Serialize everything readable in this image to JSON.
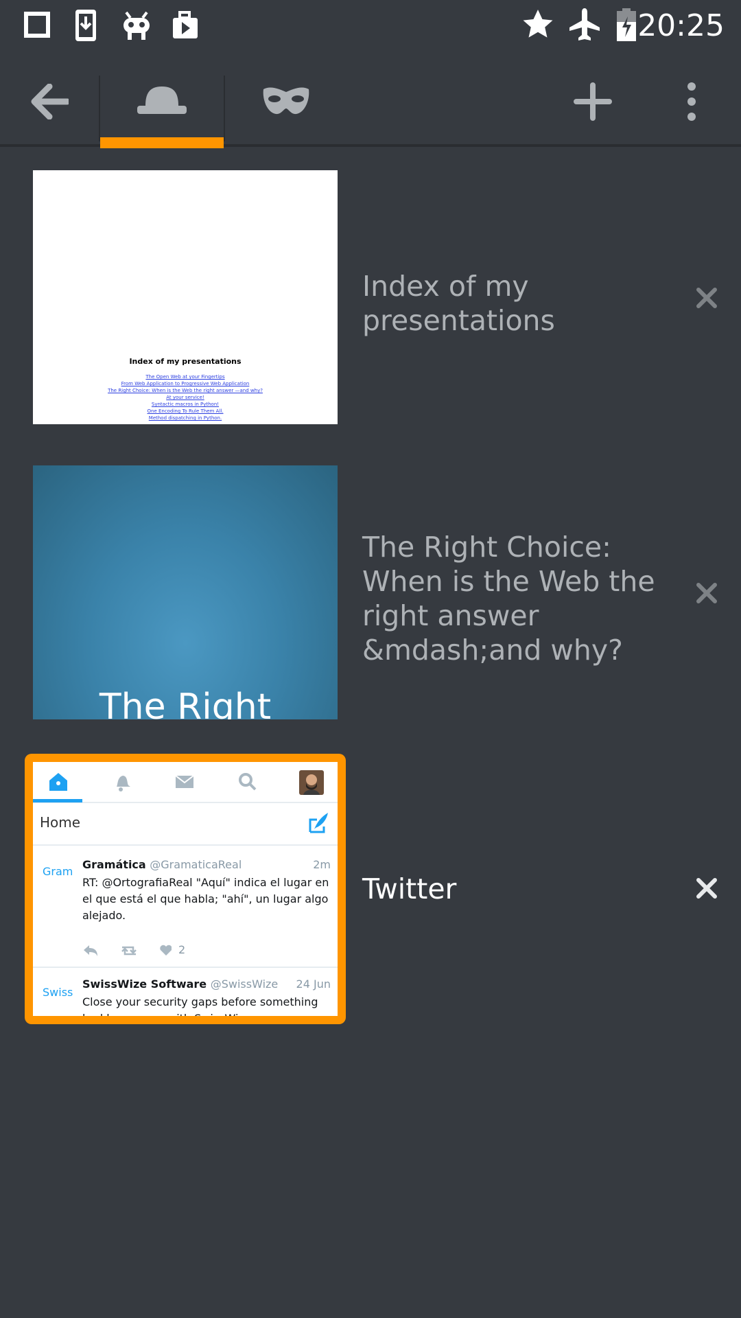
{
  "status_bar": {
    "icons": [
      "square-icon",
      "download-icon",
      "cyanogen-mascot-icon",
      "media-icon",
      "star-icon",
      "airplane-icon",
      "battery-charging-icon"
    ],
    "time": "20:25"
  },
  "toolbar": {
    "icons": [
      "back-arrow-icon",
      "normal-tabs-hat-icon",
      "private-tabs-mask-icon",
      "add-tab-icon",
      "overflow-menu-icon"
    ],
    "indicator_color": "#ff9500"
  },
  "tabs": [
    {
      "title": "Index of my presentations",
      "thumbnail": {
        "heading": "Index of my presentations",
        "links": [
          "The Open Web at your Fingertips",
          "From Web Application to Progressive Web Application",
          "The Right Choice: When is the Web the right answer —and why?",
          "At your service!",
          "Syntactic macros in Python!",
          "One Encoding To Rule Them All.",
          "Method dispatching in Python."
        ]
      },
      "selected": false
    },
    {
      "title": "The Right Choice: When is the Web the right answer &mdash;and why?",
      "thumbnail": {
        "text": "The Right"
      },
      "selected": false
    },
    {
      "title": "Twitter",
      "thumbnail": {
        "page_label": "Home",
        "tweets": [
          {
            "avatar_text": "Gram",
            "name": "Gramática",
            "handle": "@GramaticaReal",
            "time": "2m",
            "text": "RT: @OrtografiaReal \"Aquí\" indica el lugar en el que está el que habla; \"ahí\", un lugar algo alejado.",
            "likes": "2"
          },
          {
            "avatar_text": "Swiss",
            "name": "SwissWize Software",
            "handle": "@SwissWize",
            "time": "24 Jun",
            "text": "Close your security gaps before something bad happens... with SwissWize"
          }
        ]
      },
      "selected": true
    }
  ]
}
